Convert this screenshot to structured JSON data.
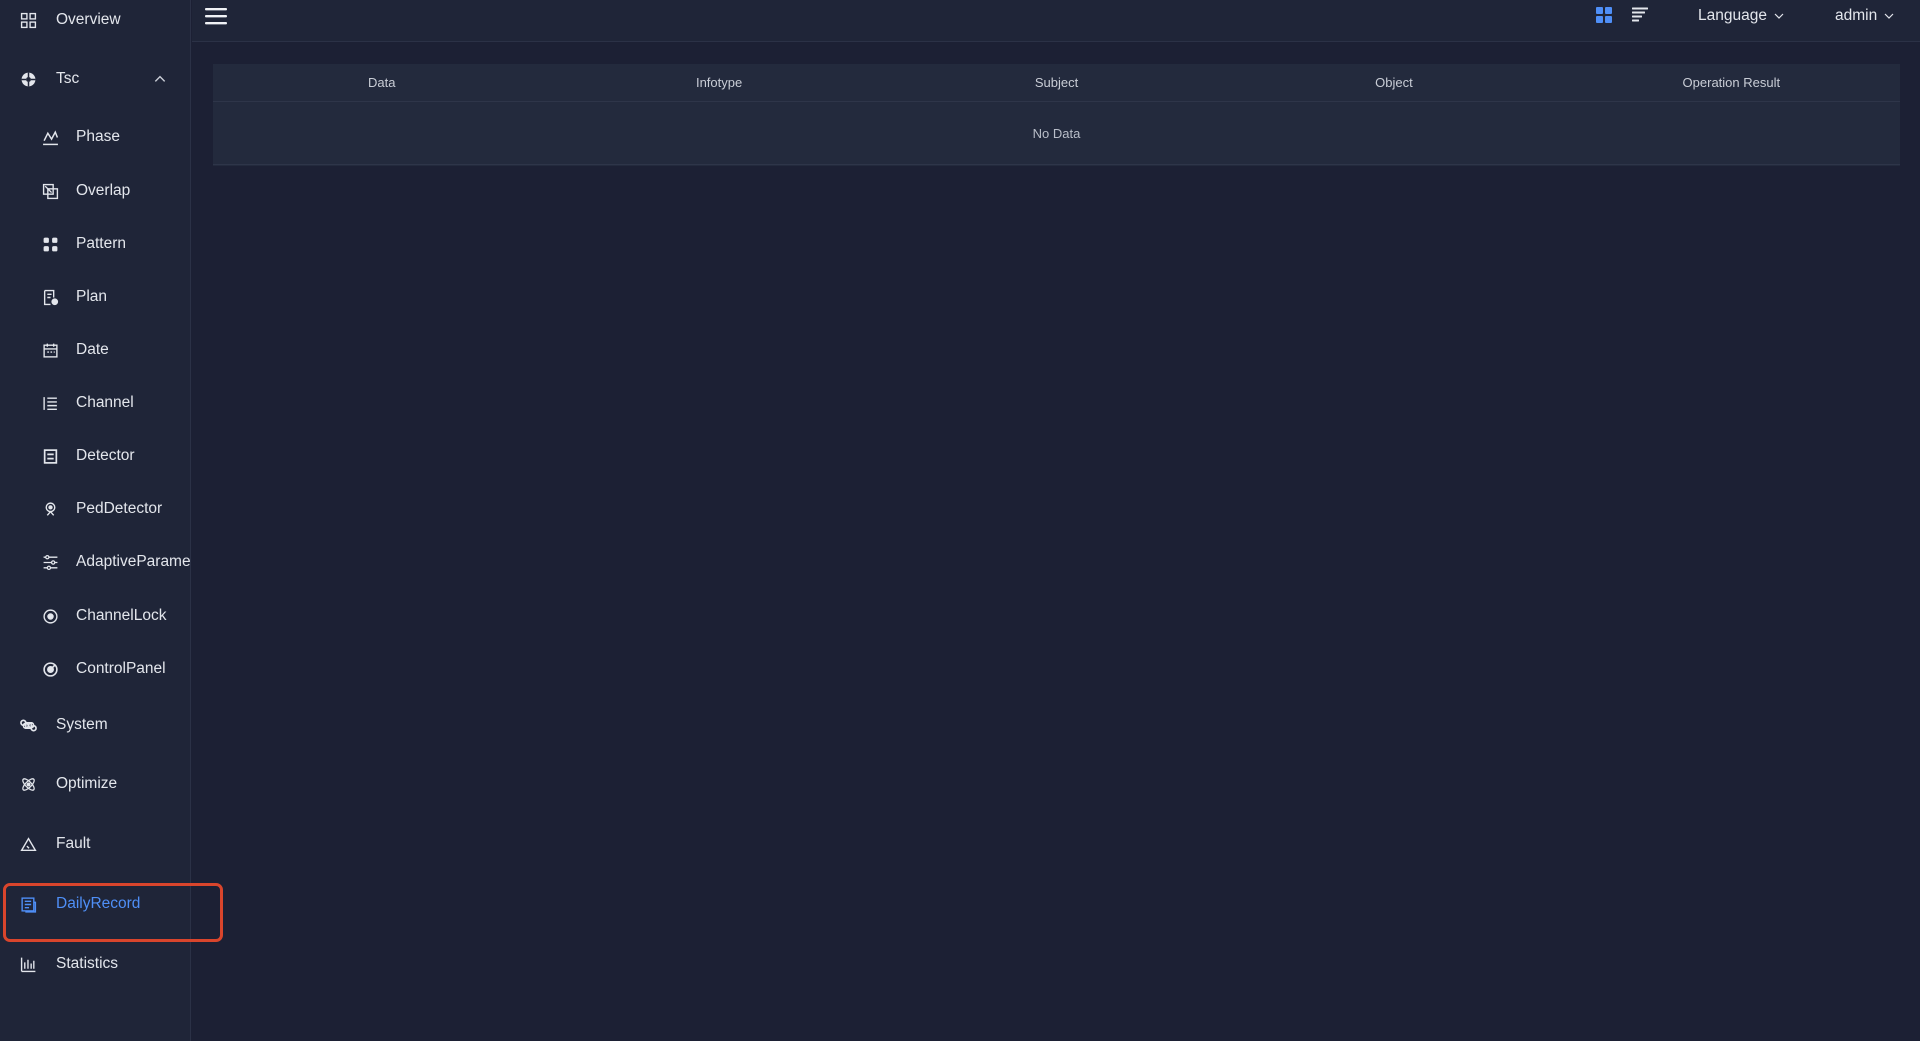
{
  "sidebar": {
    "items": [
      {
        "label": "Overview",
        "icon": "overview-grid-icon"
      },
      {
        "label": "Tsc",
        "icon": "tsc-aperture-icon",
        "expanded": true
      },
      {
        "label": "Phase",
        "icon": "phase-chart-icon"
      },
      {
        "label": "Overlap",
        "icon": "overlap-icon"
      },
      {
        "label": "Pattern",
        "icon": "pattern-icon"
      },
      {
        "label": "Plan",
        "icon": "plan-document-icon"
      },
      {
        "label": "Date",
        "icon": "calendar-icon"
      },
      {
        "label": "Channel",
        "icon": "channel-list-icon"
      },
      {
        "label": "Detector",
        "icon": "detector-icon"
      },
      {
        "label": "PedDetector",
        "icon": "pedestrian-icon"
      },
      {
        "label": "AdaptiveParame",
        "icon": "sliders-icon"
      },
      {
        "label": "ChannelLock",
        "icon": "lock-circle-icon"
      },
      {
        "label": "ControlPanel",
        "icon": "control-dial-icon"
      },
      {
        "label": "System",
        "icon": "command-icon"
      },
      {
        "label": "Optimize",
        "icon": "atom-icon"
      },
      {
        "label": "Fault",
        "icon": "warning-triangle-icon"
      },
      {
        "label": "DailyRecord",
        "icon": "daily-record-icon",
        "active": true
      },
      {
        "label": "Statistics",
        "icon": "bar-chart-icon"
      }
    ]
  },
  "header": {
    "language_label": "Language",
    "user_label": "admin"
  },
  "table": {
    "columns": [
      "Data",
      "Infotype",
      "Subject",
      "Object",
      "Operation Result"
    ],
    "empty_text": "No Data"
  },
  "colors": {
    "background": "#1c2034",
    "panel": "#1f2538",
    "accent": "#4f8ff7",
    "highlight": "#d9452c"
  }
}
